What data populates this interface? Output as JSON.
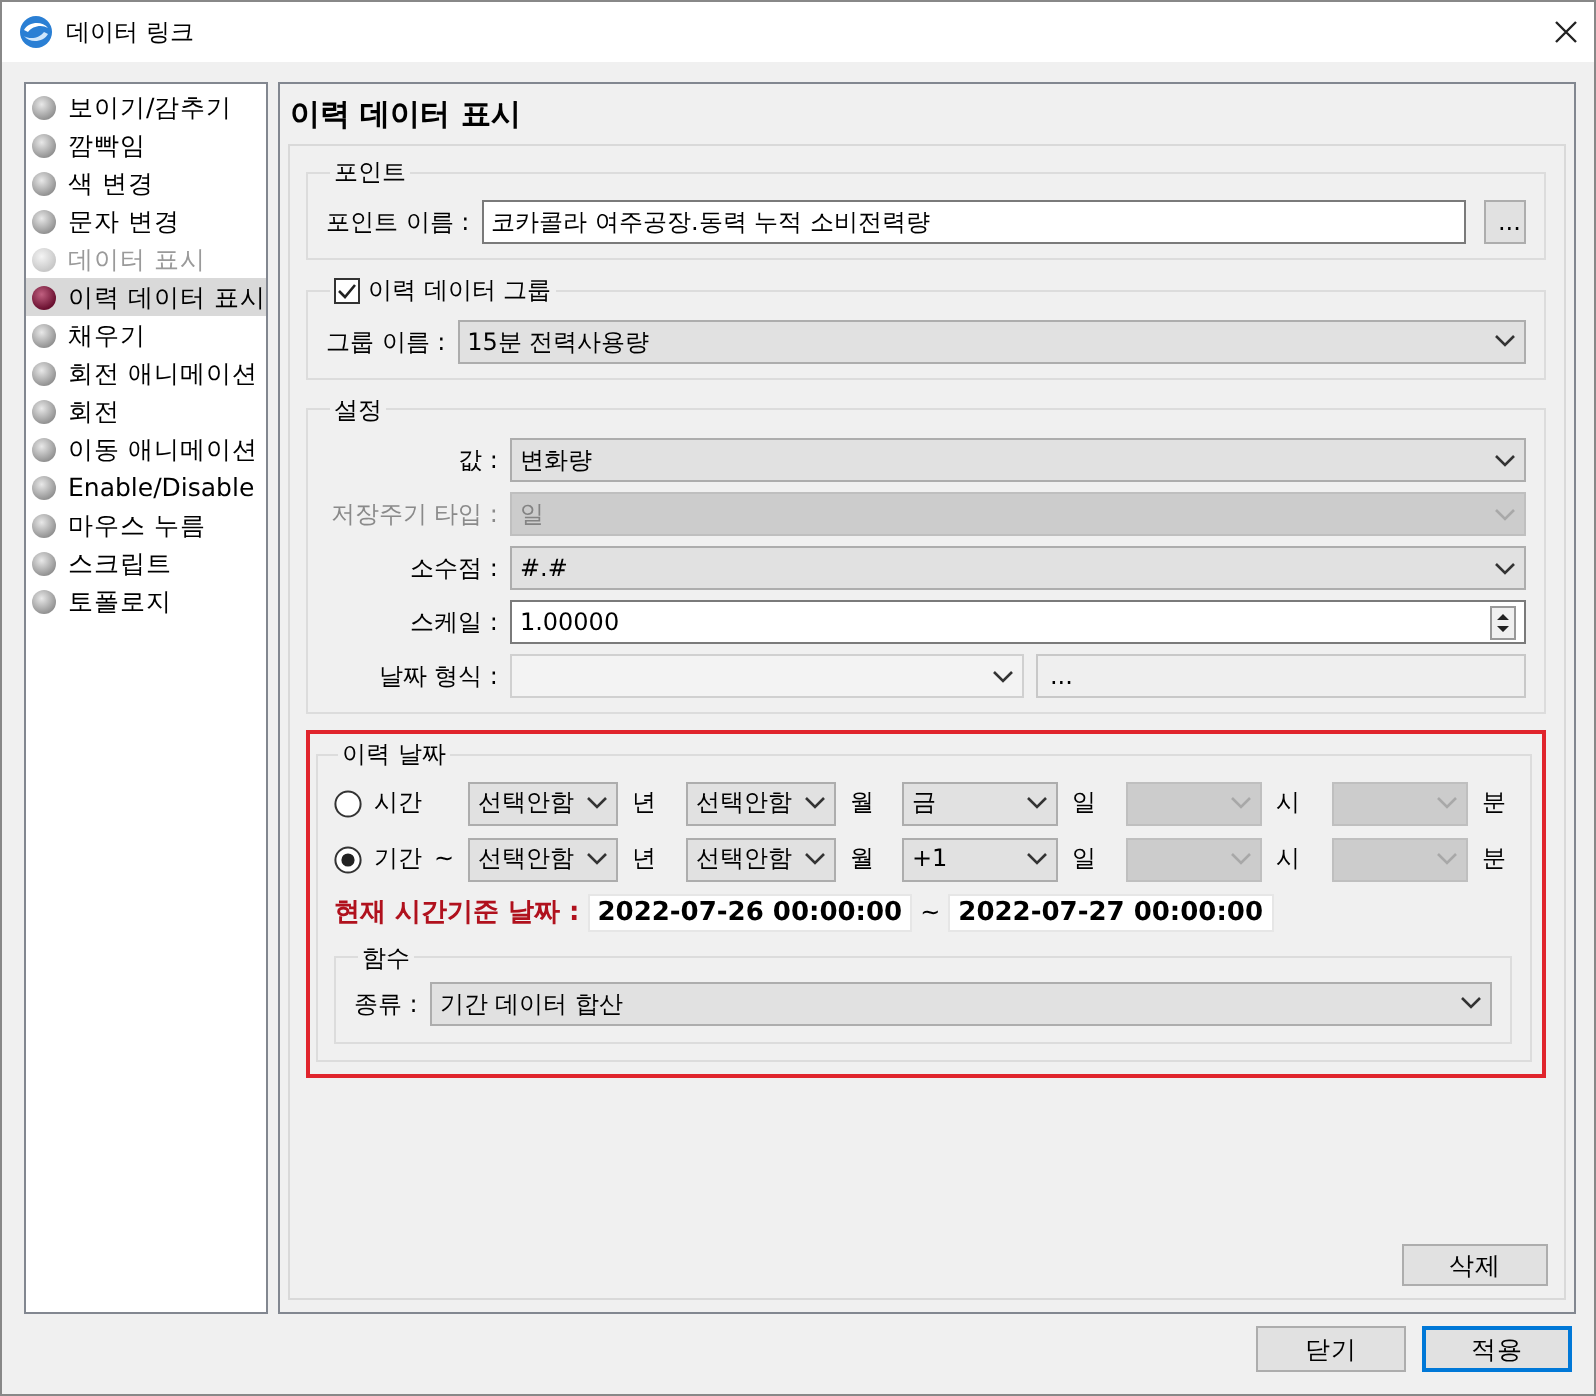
{
  "window": {
    "title": "데이터 링크"
  },
  "sidebar": {
    "items": [
      {
        "label": "보이기/감추기",
        "selected": false,
        "disabled": false
      },
      {
        "label": "깜빡임",
        "selected": false,
        "disabled": false
      },
      {
        "label": "색 변경",
        "selected": false,
        "disabled": false
      },
      {
        "label": "문자 변경",
        "selected": false,
        "disabled": false
      },
      {
        "label": "데이터 표시",
        "selected": false,
        "disabled": true
      },
      {
        "label": "이력 데이터 표시",
        "selected": true,
        "disabled": false
      },
      {
        "label": "채우기",
        "selected": false,
        "disabled": false
      },
      {
        "label": "회전 애니메이션",
        "selected": false,
        "disabled": false
      },
      {
        "label": "회전",
        "selected": false,
        "disabled": false
      },
      {
        "label": "이동 애니메이션",
        "selected": false,
        "disabled": false
      },
      {
        "label": "Enable/Disable",
        "selected": false,
        "disabled": false
      },
      {
        "label": "마우스 누름",
        "selected": false,
        "disabled": false
      },
      {
        "label": "스크립트",
        "selected": false,
        "disabled": false
      },
      {
        "label": "토폴로지",
        "selected": false,
        "disabled": false
      }
    ]
  },
  "panel": {
    "title": "이력 데이터 표시",
    "point": {
      "legend": "포인트",
      "label": "포인트 이름 :",
      "value": "코카콜라 여주공장.동력 누적 소비전력량",
      "button": "..."
    },
    "group": {
      "legend": "이력 데이터 그룹",
      "checked": true,
      "label": "그룹 이름 :",
      "value": "15분 전력사용량"
    },
    "settings": {
      "legend": "설정",
      "fields": [
        {
          "kind": "select",
          "label": "값 :",
          "value": "변화량",
          "disabled": false
        },
        {
          "kind": "select",
          "label": "저장주기 타입 :",
          "value": "일",
          "disabled": true
        },
        {
          "kind": "select",
          "label": "소수점 :",
          "value": "#.#",
          "disabled": false
        },
        {
          "kind": "spin",
          "label": "스케일 :",
          "value": "1.00000",
          "disabled": false
        },
        {
          "kind": "select_button",
          "label": "날짜 형식 :",
          "disabled": true,
          "button": "..."
        }
      ]
    },
    "history_date": {
      "legend": "이력 날짜",
      "highlighted": true,
      "rows": [
        {
          "label": "시간",
          "selected": false,
          "selects": [
            {
              "value": "선택안함",
              "disabled": false,
              "unit": "년"
            },
            {
              "value": "선택안함",
              "disabled": false,
              "unit": "월"
            },
            {
              "value": "금",
              "disabled": false,
              "unit": "일"
            },
            {
              "disabled": true,
              "unit": "시"
            },
            {
              "disabled": true,
              "unit": "분"
            }
          ]
        },
        {
          "label": "기간",
          "tilde": "~",
          "selected": true,
          "selects": [
            {
              "value": "선택안함",
              "disabled": false,
              "unit": "년"
            },
            {
              "value": "선택안함",
              "disabled": false,
              "unit": "월"
            },
            {
              "value": "+1",
              "disabled": false,
              "unit": "일"
            },
            {
              "disabled": true,
              "unit": "시"
            },
            {
              "disabled": true,
              "unit": "분"
            }
          ]
        }
      ],
      "current": {
        "label": "현재 시간기준 날짜 :",
        "from": "2022-07-26 00:00:00",
        "separator": "~",
        "to": "2022-07-27 00:00:00"
      },
      "function": {
        "legend": "함수",
        "label": "종류 :",
        "value": "기간 데이터 합산"
      }
    },
    "delete_button": "삭제"
  },
  "footer_buttons": [
    {
      "label": "닫기",
      "default": false
    },
    {
      "label": "적용",
      "default": true
    }
  ]
}
